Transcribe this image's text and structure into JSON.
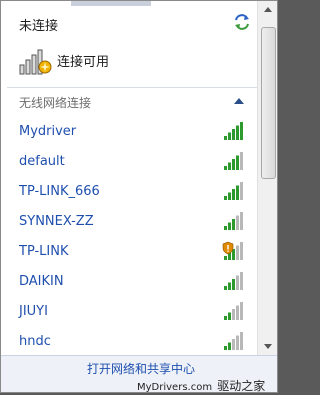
{
  "header": {
    "status_title": "未连接",
    "available_text": "连接可用"
  },
  "section": {
    "title": "无线网络连接"
  },
  "networks": [
    {
      "name": "Mydriver",
      "signal_bars": 5,
      "secured": false
    },
    {
      "name": "default",
      "signal_bars": 4,
      "secured": false
    },
    {
      "name": "TP-LINK_666",
      "signal_bars": 4,
      "secured": false
    },
    {
      "name": "SYNNEX-ZZ",
      "signal_bars": 3,
      "secured": false
    },
    {
      "name": "TP-LINK",
      "signal_bars": 3,
      "secured": true
    },
    {
      "name": "DAIKIN",
      "signal_bars": 3,
      "secured": false
    },
    {
      "name": "JIUYI",
      "signal_bars": 2,
      "secured": false
    },
    {
      "name": "hndc",
      "signal_bars": 2,
      "secured": false
    }
  ],
  "footer": {
    "link_text": "打开网络和共享中心",
    "watermark_url": "MyDrivers.com",
    "watermark_cn": "驱动之家"
  },
  "colors": {
    "signal_active": "#2c9a2c",
    "signal_inactive": "#b8b8b8",
    "link": "#1f4fae",
    "shield_warning": "#e08a00"
  }
}
